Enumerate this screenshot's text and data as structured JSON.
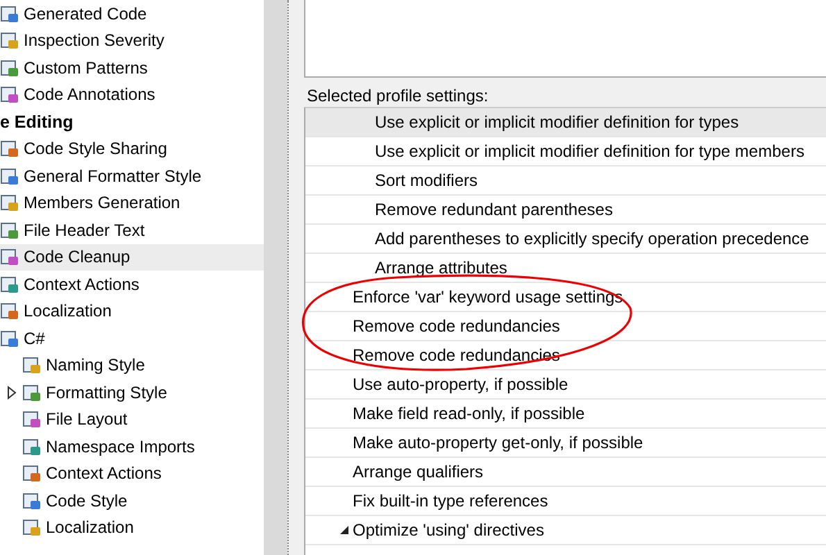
{
  "tree": [
    {
      "kind": "item",
      "label": "Generated Code",
      "selected": false
    },
    {
      "kind": "item",
      "label": "Inspection Severity",
      "selected": false
    },
    {
      "kind": "item",
      "label": "Custom Patterns",
      "selected": false
    },
    {
      "kind": "item",
      "label": "Code Annotations",
      "selected": false
    },
    {
      "kind": "header",
      "label": "e Editing"
    },
    {
      "kind": "item",
      "label": "Code Style Sharing",
      "selected": false
    },
    {
      "kind": "item",
      "label": "General Formatter Style",
      "selected": false
    },
    {
      "kind": "item",
      "label": "Members Generation",
      "selected": false
    },
    {
      "kind": "item",
      "label": "File Header Text",
      "selected": false
    },
    {
      "kind": "item",
      "label": "Code Cleanup",
      "selected": true
    },
    {
      "kind": "item",
      "label": "Context Actions",
      "selected": false
    },
    {
      "kind": "item",
      "label": "Localization",
      "selected": false
    },
    {
      "kind": "item",
      "label": "C#",
      "selected": false,
      "children": [
        {
          "kind": "item",
          "label": "Naming Style",
          "selected": false
        },
        {
          "kind": "item",
          "label": "Formatting Style",
          "selected": false,
          "expanded": false
        },
        {
          "kind": "item",
          "label": "File Layout",
          "selected": false
        },
        {
          "kind": "item",
          "label": "Namespace Imports",
          "selected": false
        },
        {
          "kind": "item",
          "label": "Context Actions",
          "selected": false
        },
        {
          "kind": "item",
          "label": "Code Style",
          "selected": false
        },
        {
          "kind": "item",
          "label": "Localization",
          "selected": false
        }
      ]
    }
  ],
  "settings_label": "Selected profile settings:",
  "settings": [
    {
      "children": [
        {
          "label": "Use explicit or implicit modifier definition for types",
          "selected": true
        },
        {
          "label": "Use explicit or implicit modifier definition for type members",
          "selected": false
        },
        {
          "label": "Sort modifiers",
          "selected": false
        },
        {
          "label": "Remove redundant parentheses",
          "selected": false
        },
        {
          "label": "Add parentheses to explicitly specify operation precedence",
          "selected": false
        },
        {
          "label": "Arrange attributes",
          "selected": false
        }
      ]
    },
    {
      "label": "Enforce 'var' keyword usage settings",
      "selected": false
    },
    {
      "label": "Remove code redundancies",
      "selected": false
    },
    {
      "label": "Remove code redundancies",
      "selected": false
    },
    {
      "label": "Use auto-property, if possible",
      "selected": false
    },
    {
      "label": "Make field read-only, if possible",
      "selected": false
    },
    {
      "label": "Make auto-property get-only, if possible",
      "selected": false
    },
    {
      "label": "Arrange qualifiers",
      "selected": false
    },
    {
      "label": "Fix built-in type references",
      "selected": false
    },
    {
      "label": "Optimize 'using' directives",
      "selected": false,
      "expanded": true
    }
  ]
}
